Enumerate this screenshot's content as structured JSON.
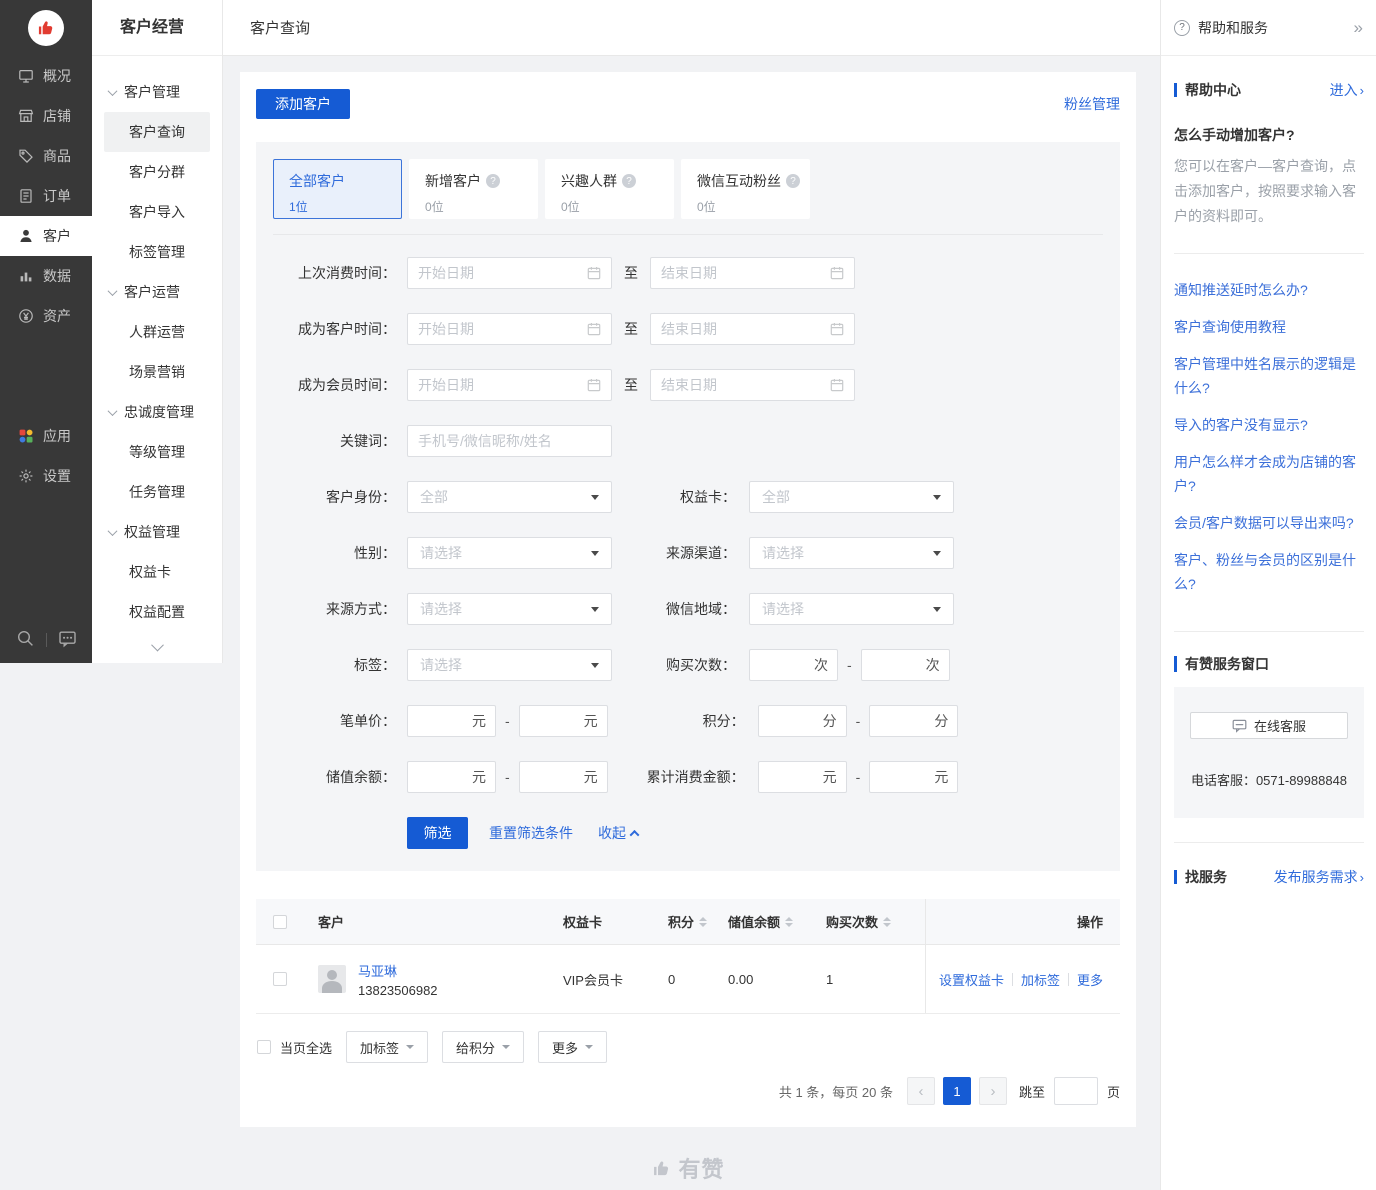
{
  "left_nav": {
    "items": [
      {
        "label": "概况"
      },
      {
        "label": "店铺"
      },
      {
        "label": "商品"
      },
      {
        "label": "订单"
      },
      {
        "label": "客户"
      },
      {
        "label": "数据"
      },
      {
        "label": "资产"
      }
    ],
    "apps": "应用",
    "settings": "设置"
  },
  "menu": {
    "title": "客户经营",
    "items": [
      {
        "label": "客户管理"
      },
      {
        "label": "客户查询"
      },
      {
        "label": "客户分群"
      },
      {
        "label": "客户导入"
      },
      {
        "label": "标签管理"
      },
      {
        "label": "客户运营"
      },
      {
        "label": "人群运营"
      },
      {
        "label": "场景营销"
      },
      {
        "label": "忠诚度管理"
      },
      {
        "label": "等级管理"
      },
      {
        "label": "任务管理"
      },
      {
        "label": "权益管理"
      },
      {
        "label": "权益卡"
      },
      {
        "label": "权益配置"
      }
    ]
  },
  "topbar": {
    "title": "客户查询"
  },
  "main": {
    "add_button": "添加客户",
    "fans_link": "粉丝管理",
    "tabs": [
      {
        "label": "全部客户",
        "count": "1位"
      },
      {
        "label": "新增客户",
        "count": "0位"
      },
      {
        "label": "兴趣人群",
        "count": "0位"
      },
      {
        "label": "微信互动粉丝",
        "count": "0位"
      }
    ],
    "filters": {
      "date_rows": [
        {
          "label": "上次消费时间：",
          "start": "开始日期",
          "to": "至",
          "end": "结束日期"
        },
        {
          "label": "成为客户时间：",
          "start": "开始日期",
          "to": "至",
          "end": "结束日期"
        },
        {
          "label": "成为会员时间：",
          "start": "开始日期",
          "to": "至",
          "end": "结束日期"
        }
      ],
      "keyword": {
        "label": "关键词：",
        "placeholder": "手机号/微信昵称/姓名"
      },
      "selects": [
        {
          "label": "客户身份：",
          "value": "全部"
        },
        {
          "label": "权益卡：",
          "value": "全部"
        },
        {
          "label": "性别：",
          "value": "请选择"
        },
        {
          "label": "来源渠道：",
          "value": "请选择"
        },
        {
          "label": "来源方式：",
          "value": "请选择"
        },
        {
          "label": "微信地域：",
          "value": "请选择"
        },
        {
          "label": "标签：",
          "value": "请选择"
        }
      ],
      "ranges": [
        {
          "label": "购买次数：",
          "unit": "次"
        },
        {
          "label": "笔单价：",
          "unit": "元"
        },
        {
          "label": "积分：",
          "unit": "分"
        },
        {
          "label": "储值余额：",
          "unit": "元"
        },
        {
          "label": "累计消费金额：",
          "unit": "元"
        }
      ],
      "dash": "-",
      "actions": {
        "submit": "筛选",
        "reset": "重置筛选条件",
        "collapse": "收起"
      }
    },
    "table": {
      "columns": {
        "customer": "客户",
        "card": "权益卡",
        "points": "积分",
        "balance": "储值余额",
        "purchases": "购买次数",
        "ops": "操作"
      },
      "row": {
        "name": "马亚琳",
        "phone": "13823506982",
        "card": "VIP会员卡",
        "points": "0",
        "balance": "0.00",
        "purchases": "1",
        "op1": "设置权益卡",
        "op2": "加标签",
        "op3": "更多"
      }
    },
    "bulk": {
      "select_all": "当页全选",
      "tag": "加标签",
      "points": "给积分",
      "more": "更多"
    },
    "pagination": {
      "summary": "共 1 条，每页 20 条",
      "page": "1",
      "jump": "跳至",
      "unit": "页"
    }
  },
  "help": {
    "header": "帮助和服务",
    "center": {
      "title": "帮助中心",
      "enter": "进入",
      "arrow": "›"
    },
    "faq": {
      "q": "怎么手动增加客户?",
      "a": "您可以在客户—客户查询，点击添加客户，按照要求输入客户的资料即可。"
    },
    "links": [
      {
        "label": "通知推送延时怎么办?"
      },
      {
        "label": "客户查询使用教程"
      },
      {
        "label": "客户管理中姓名展示的逻辑是什么?"
      },
      {
        "label": "导入的客户没有显示?"
      },
      {
        "label": "用户怎么样才会成为店铺的客户?"
      },
      {
        "label": "会员/客户数据可以导出来吗?"
      },
      {
        "label": "客户、粉丝与会员的区别是什么?"
      }
    ],
    "service": {
      "title": "有赞服务窗口",
      "online": "在线客服",
      "phone": "电话客服：0571-89988848"
    },
    "find": {
      "title": "找服务",
      "publish": "发布服务需求",
      "arrow": "›"
    }
  },
  "footer": {
    "brand": "有赞"
  },
  "colors": {
    "primary": "#155bd4",
    "link": "#2f6bdb",
    "sidebar": "#383838"
  }
}
